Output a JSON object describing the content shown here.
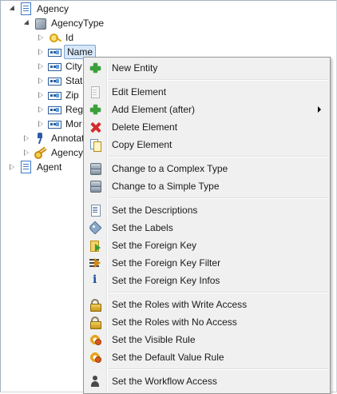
{
  "tree": {
    "items": [
      {
        "label": "Agency",
        "icon": "document-icon",
        "expanded": true
      },
      {
        "label": "AgencyType",
        "icon": "complex-type-icon",
        "expanded": true
      },
      {
        "label": "Id",
        "icon": "key-icon",
        "expanded": false
      },
      {
        "label": "Name",
        "icon": "field-icon",
        "expanded": false,
        "selected": true
      },
      {
        "label": "City",
        "icon": "field-icon"
      },
      {
        "label": "Stat",
        "icon": "field-icon"
      },
      {
        "label": "Zip",
        "icon": "field-icon"
      },
      {
        "label": "Reg",
        "icon": "field-icon"
      },
      {
        "label": "Mor",
        "icon": "field-icon"
      },
      {
        "label": "Annotat",
        "icon": "pin-icon"
      },
      {
        "label": "Agency",
        "icon": "keys-icon"
      },
      {
        "label": "Agent",
        "icon": "document-icon"
      }
    ]
  },
  "context_menu": {
    "items": [
      {
        "label": "New Entity",
        "icon": "plus-icon",
        "enabled": true
      },
      {
        "label": "Edit Element",
        "icon": "page-icon",
        "enabled": true
      },
      {
        "label": "Add Element (after)",
        "icon": "plus-icon",
        "enabled": true,
        "submenu": true
      },
      {
        "label": "Delete Element",
        "icon": "delete-icon",
        "enabled": true
      },
      {
        "label": "Copy Element",
        "icon": "copy-icon",
        "enabled": true
      },
      {
        "label": "Change to a Complex Type",
        "icon": "complex-type-icon",
        "enabled": true
      },
      {
        "label": "Change to a Simple Type",
        "icon": "complex-type-icon",
        "enabled": true
      },
      {
        "label": "Set the Descriptions",
        "icon": "description-icon",
        "enabled": true
      },
      {
        "label": "Set the Labels",
        "icon": "tag-icon",
        "enabled": true
      },
      {
        "label": "Set the Foreign Key",
        "icon": "foreign-key-icon",
        "enabled": true
      },
      {
        "label": "Set the Foreign Key Filter",
        "icon": "filter-icon",
        "enabled": true
      },
      {
        "label": "Set the Foreign Key Infos",
        "icon": "info-icon",
        "enabled": true
      },
      {
        "label": "Set the Roles with Write Access",
        "icon": "lock-icon",
        "enabled": true
      },
      {
        "label": "Set the Roles with No Access",
        "icon": "lock-icon",
        "enabled": true
      },
      {
        "label": "Set the Visible Rule",
        "icon": "gear-icon",
        "enabled": true
      },
      {
        "label": "Set the Default Value Rule",
        "icon": "gear-icon",
        "enabled": true
      },
      {
        "label": "Set the Workflow Access",
        "icon": "user-icon",
        "enabled": true
      }
    ]
  }
}
